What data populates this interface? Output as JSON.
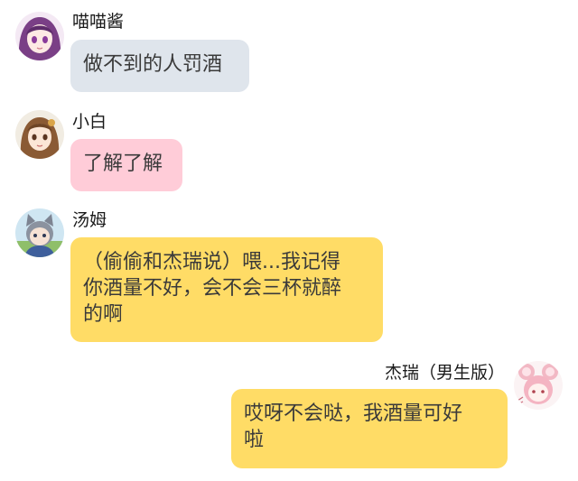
{
  "chat": {
    "messages": [
      {
        "sender": "喵喵酱",
        "lines": [
          "做不到的人罚酒"
        ],
        "bubble_color": "#dfe5ec",
        "avatar_icon": "anime-girl-purple-hair-avatar"
      },
      {
        "sender": "小白",
        "lines": [
          "了解了解"
        ],
        "bubble_color": "#ffccd8",
        "avatar_icon": "anime-girl-brown-hair-avatar"
      },
      {
        "sender": "汤姆",
        "lines": [
          "（偷偷和杰瑞说）喂...我记得",
          "你酒量不好，会不会三杯就醉",
          "的啊"
        ],
        "bubble_color": "#ffdc66",
        "avatar_icon": "cat-ear-boy-avatar"
      },
      {
        "sender": "杰瑞（男生版）",
        "lines": [
          "哎呀不会哒，我酒量可好",
          "啦"
        ],
        "bubble_color": "#ffdc66",
        "avatar_icon": "pink-hair-mouse-avatar"
      }
    ]
  }
}
